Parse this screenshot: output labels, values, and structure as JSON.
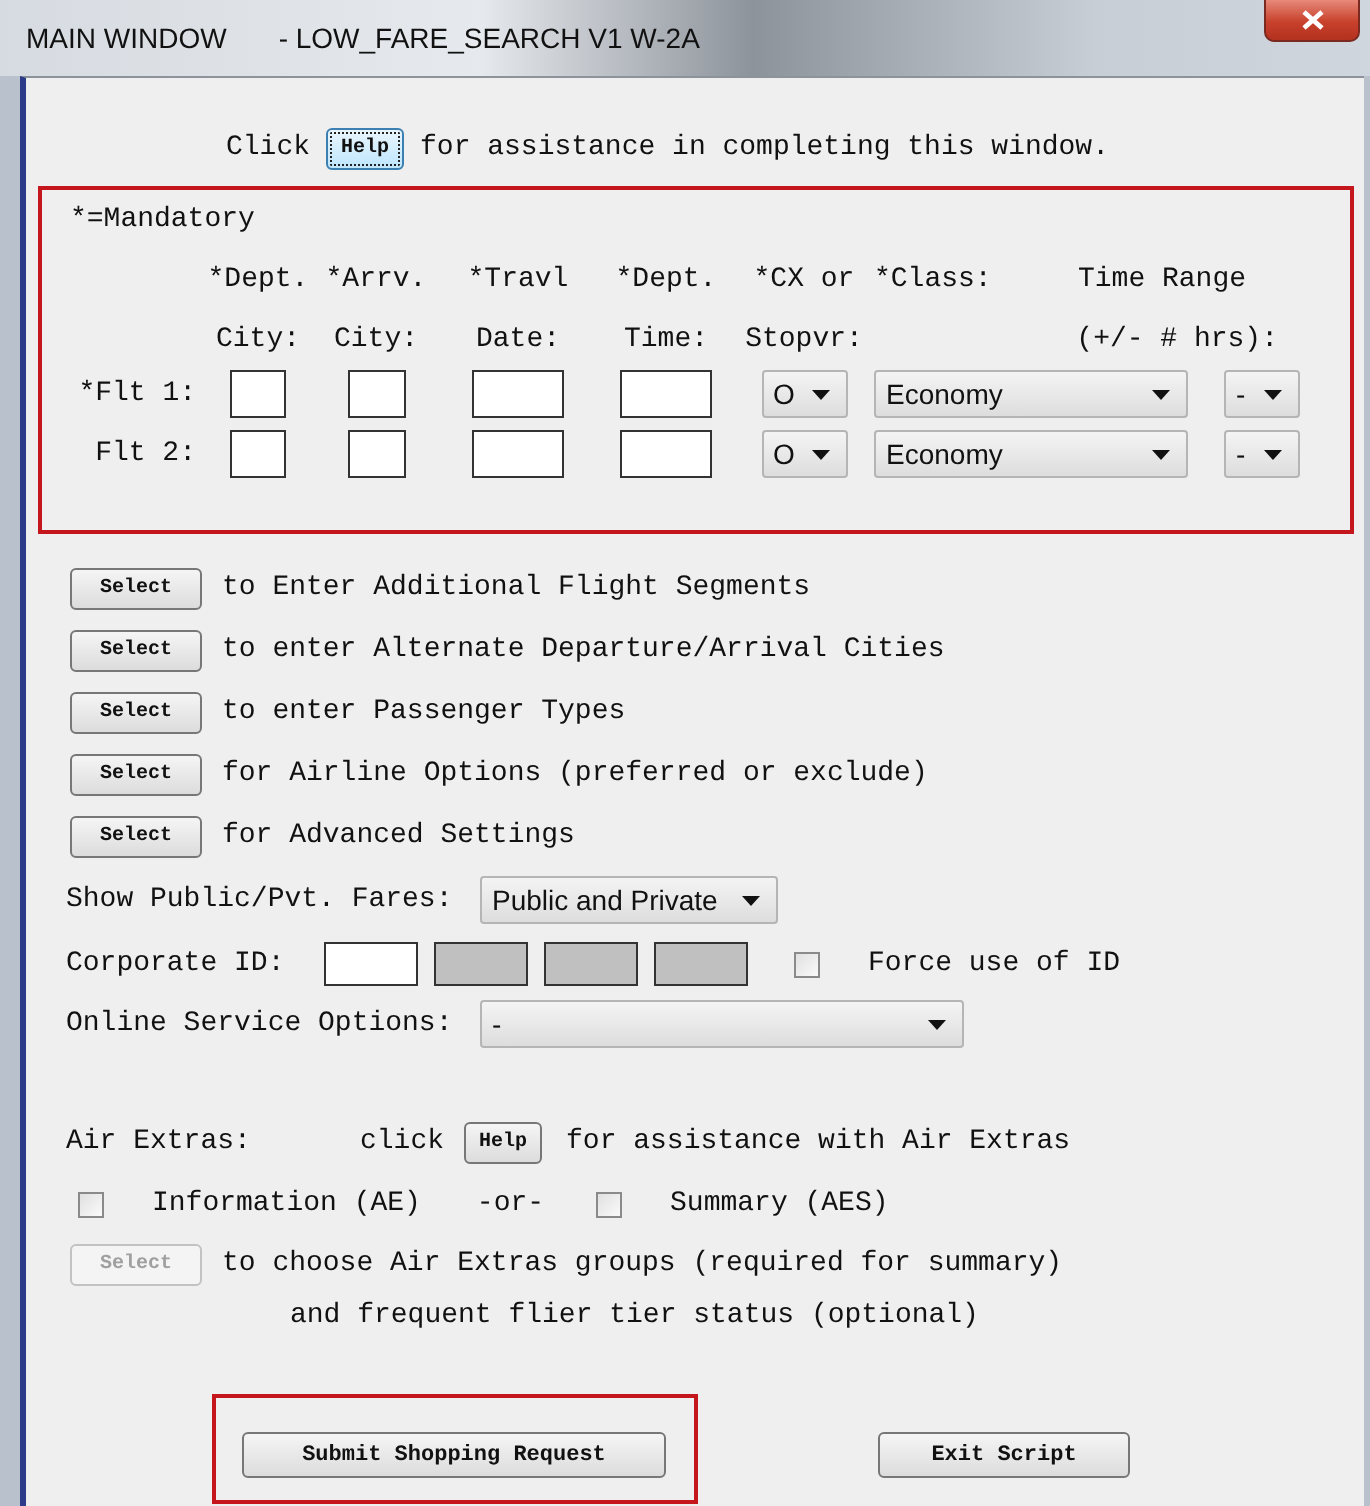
{
  "window": {
    "title": "MAIN WINDOW",
    "subtitle": "- LOW_FARE_SEARCH V1 W-2A"
  },
  "help_line": {
    "prefix": "Click",
    "button": "Help",
    "suffix": "for assistance in completing this window."
  },
  "flights": {
    "highlighted": true,
    "mandatory_note": "*=Mandatory",
    "headers": [
      {
        "line1": "*Dept.",
        "line2": "City:"
      },
      {
        "line1": "*Arrv.",
        "line2": "City:"
      },
      {
        "line1": "*Travl",
        "line2": "Date:"
      },
      {
        "line1": "*Dept.",
        "line2": "Time:"
      },
      {
        "line1": "*CX or",
        "line2": "Stopvr:"
      },
      {
        "line1": "*Class:"
      },
      {
        "line1": "Time Range",
        "line2": "(+/- # hrs):"
      }
    ],
    "rows": [
      {
        "label": "*Flt 1:",
        "cx": "O",
        "class": "Economy",
        "time_range": "-"
      },
      {
        "label": "Flt 2:",
        "cx": "O",
        "class": "Economy",
        "time_range": "-"
      }
    ]
  },
  "select_rows": [
    {
      "button": "Select",
      "text": "to Enter Additional Flight Segments",
      "disabled": false
    },
    {
      "button": "Select",
      "text": "to enter Alternate Departure/Arrival Cities",
      "disabled": false
    },
    {
      "button": "Select",
      "text": "to enter Passenger Types",
      "disabled": false
    },
    {
      "button": "Select",
      "text": "for Airline Options (preferred or exclude)",
      "disabled": false
    },
    {
      "button": "Select",
      "text": "for Advanced Settings",
      "disabled": false
    }
  ],
  "fares": {
    "label": "Show Public/Pvt. Fares:",
    "value": "Public and Private"
  },
  "corporate_id": {
    "label": "Corporate ID:",
    "fields": [
      {
        "disabled": false
      },
      {
        "disabled": true
      },
      {
        "disabled": true
      },
      {
        "disabled": true
      }
    ],
    "force_label": "Force use of ID",
    "force_checked": false
  },
  "online_service": {
    "label": "Online Service Options:",
    "value": "-"
  },
  "air_extras": {
    "label": "Air Extras:",
    "click": "click",
    "button": "Help",
    "text": "for assistance with Air Extras",
    "options": [
      {
        "label": "Information (AE)",
        "checked": false
      },
      {
        "label": "Summary (AES)",
        "checked": false
      }
    ],
    "separator": "-or-",
    "select": {
      "button": "Select",
      "text": "to choose Air Extras groups (required for summary)",
      "disabled": true
    },
    "note": "and frequent flier tier status (optional)"
  },
  "buttons": [
    {
      "label": "Submit Shopping Request",
      "highlighted": true
    },
    {
      "label": "Exit Script",
      "highlighted": false
    }
  ]
}
